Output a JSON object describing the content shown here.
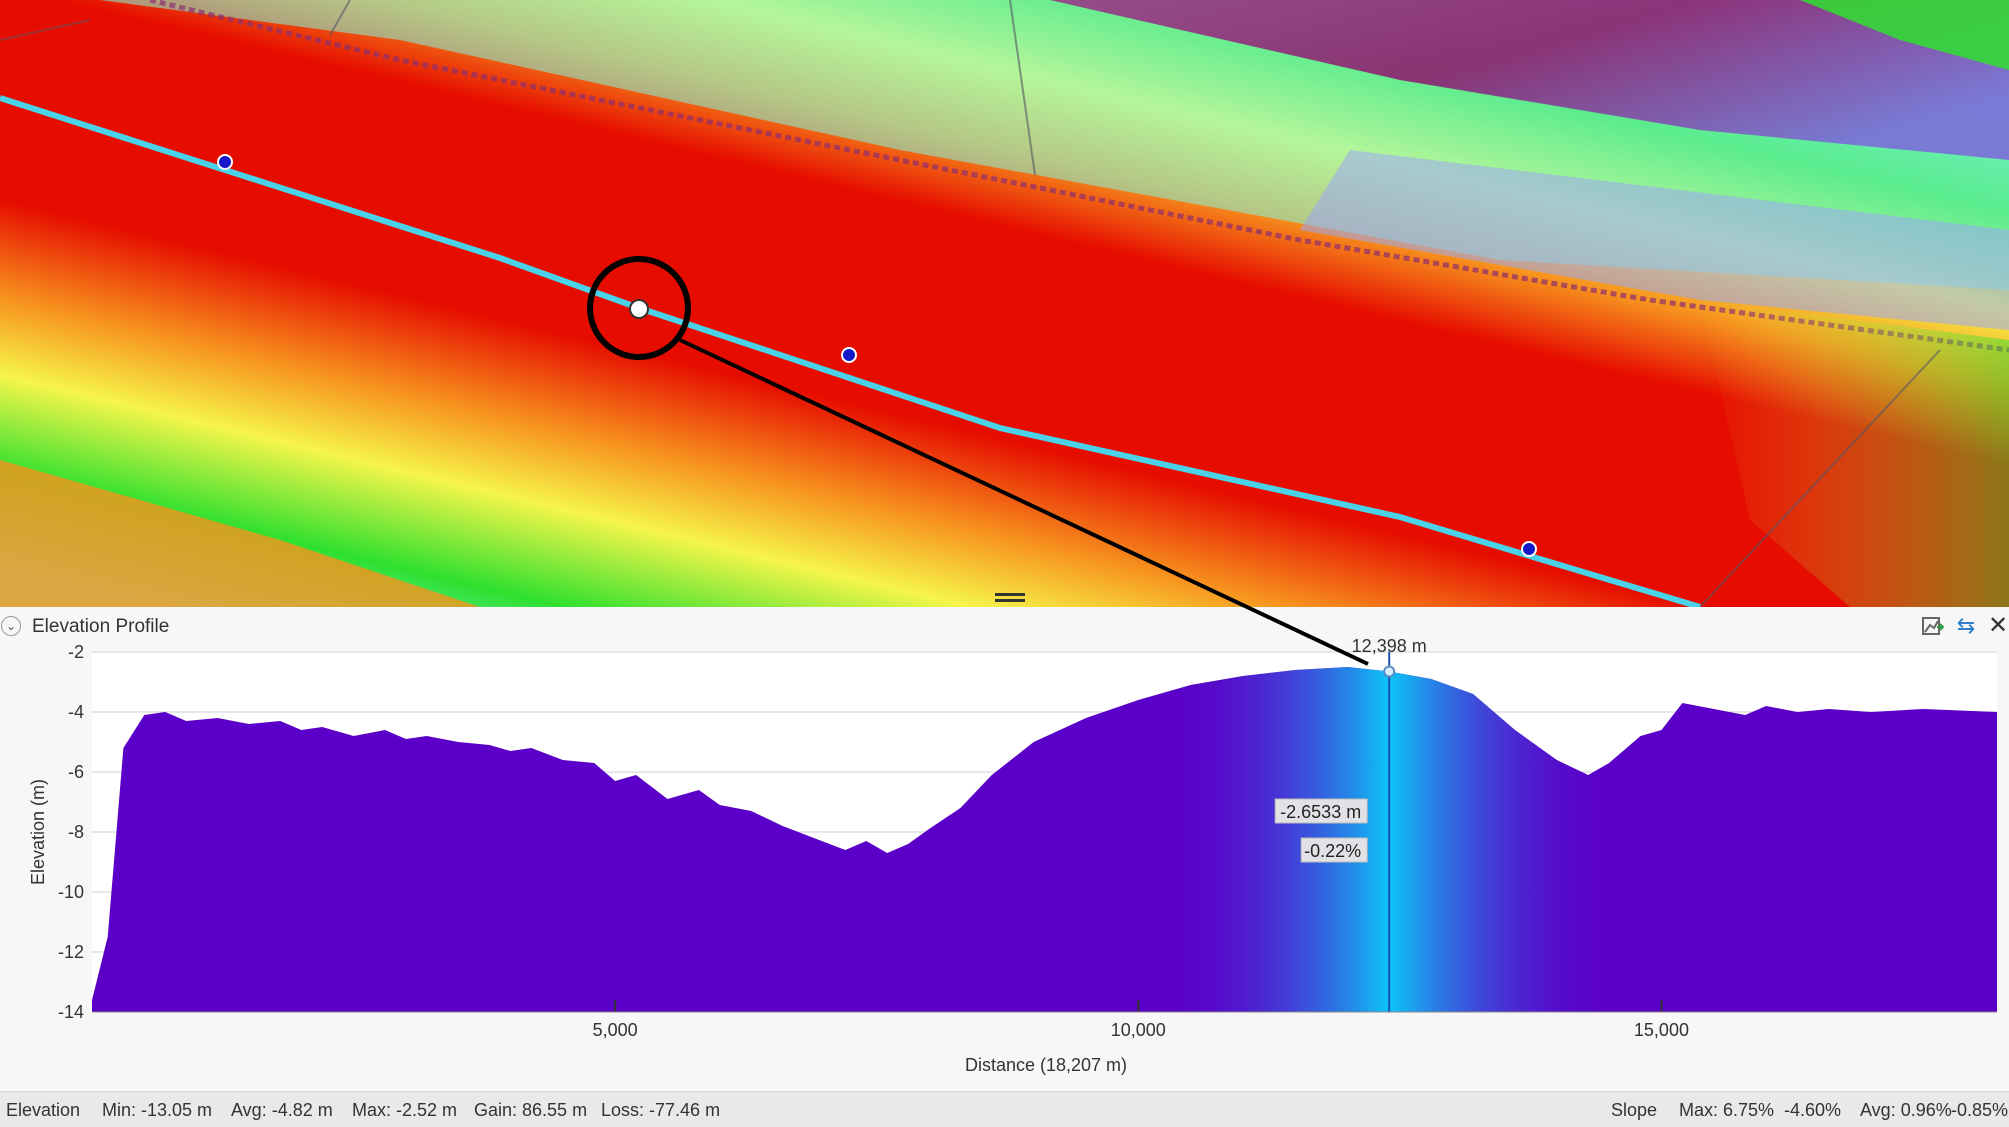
{
  "panel": {
    "title": "Elevation Profile",
    "collapse_icon": "chevron-down-icon",
    "toolbar_icons": [
      "export-chart-icon",
      "swap-direction-icon",
      "close-icon"
    ]
  },
  "map": {
    "colors": {
      "red": "#e60d00",
      "orange": "#f7931e",
      "yellow": "#f6f54a",
      "green": "#2fe02f",
      "cyan": "#6df0d8",
      "purple": "#8e1f6f",
      "profile_line": "#4ad3e8",
      "vertex": "#1518c8"
    },
    "cursor_marker": "selected-profile-point"
  },
  "chart_data": {
    "type": "area",
    "xlabel": "Distance (18,207 m)",
    "ylabel": "Elevation (m)",
    "xlim": [
      0,
      18207
    ],
    "ylim": [
      -14,
      -2
    ],
    "xticks": [
      5000,
      10000,
      15000
    ],
    "xtick_labels": [
      "5,000",
      "10,000",
      "15,000"
    ],
    "yticks": [
      -2,
      -4,
      -6,
      -8,
      -10,
      -12,
      -14
    ],
    "ytick_labels": [
      "-2",
      "-4",
      "-6",
      "-8",
      "-10",
      "-12",
      "-14"
    ],
    "grid": true,
    "fill_color": "#5b00c8",
    "highlight_color": "#0cc6f7",
    "series": [
      {
        "x": [
          0,
          150,
          300,
          500,
          700,
          900,
          1200,
          1500,
          1800,
          2000,
          2200,
          2500,
          2800,
          3000,
          3200,
          3500,
          3800,
          4000,
          4200,
          4500,
          4800,
          5000,
          5200,
          5500,
          5800,
          6000,
          6300,
          6600,
          6900,
          7200,
          7400,
          7600,
          7800,
          8000,
          8300,
          8600,
          9000,
          9500,
          10000,
          10500,
          11000,
          11500,
          12000,
          12398,
          12800,
          13200,
          13600,
          14000,
          14300,
          14500,
          14800,
          15000,
          15200,
          15500,
          15800,
          16000,
          16300,
          16600,
          17000,
          17500,
          18207
        ],
        "y": [
          -13.6,
          -11.5,
          -5.2,
          -4.1,
          -4.0,
          -4.3,
          -4.2,
          -4.4,
          -4.3,
          -4.6,
          -4.5,
          -4.8,
          -4.6,
          -4.9,
          -4.8,
          -5.0,
          -5.1,
          -5.3,
          -5.2,
          -5.6,
          -5.7,
          -6.3,
          -6.1,
          -6.9,
          -6.6,
          -7.1,
          -7.3,
          -7.8,
          -8.2,
          -8.6,
          -8.3,
          -8.7,
          -8.4,
          -7.9,
          -7.2,
          -6.1,
          -5.0,
          -4.2,
          -3.6,
          -3.1,
          -2.8,
          -2.6,
          -2.5,
          -2.65,
          -2.9,
          -3.4,
          -4.6,
          -5.6,
          -6.1,
          -5.7,
          -4.8,
          -4.6,
          -3.7,
          -3.9,
          -4.1,
          -3.8,
          -4.0,
          -3.9,
          -4.0,
          -3.9,
          -4.0
        ]
      }
    ],
    "cursor": {
      "x": 12398,
      "x_label": "12,398 m",
      "y_label": "-2.6533 m",
      "slope_label": "-0.22%"
    }
  },
  "statusbar": {
    "elevation_label": "Elevation",
    "min": "Min: -13.05 m",
    "avg": "Avg: -4.82 m",
    "max": "Max: -2.52 m",
    "gain": "Gain: 86.55 m",
    "loss": "Loss: -77.46 m",
    "slope_label": "Slope",
    "slope_max": "Max: 6.75%",
    "slope_min": "-4.60%",
    "slope_avg": "Avg: 0.96%",
    "slope_avg2": "-0.85%"
  }
}
